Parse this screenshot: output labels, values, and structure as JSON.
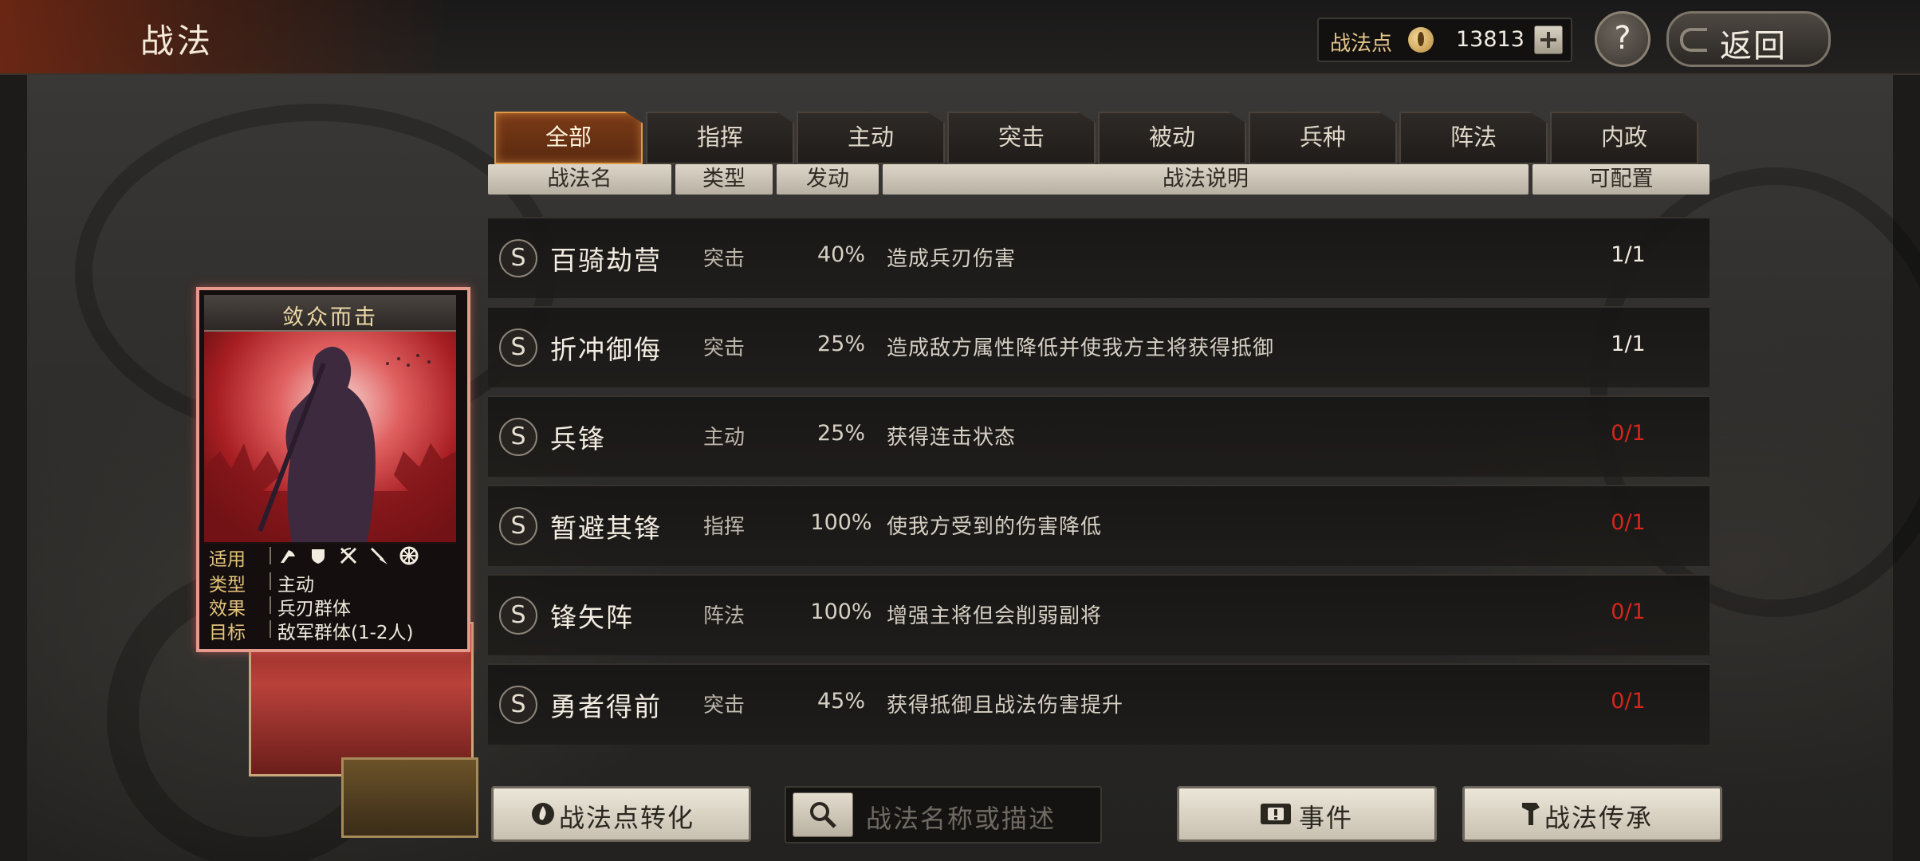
{
  "header": {
    "title": "战法",
    "points_label": "战法点",
    "points_value": "13813",
    "help_label": "?",
    "back_label": "返回"
  },
  "tabs": [
    {
      "label": "全部",
      "active": true
    },
    {
      "label": "指挥",
      "active": false
    },
    {
      "label": "主动",
      "active": false
    },
    {
      "label": "突击",
      "active": false
    },
    {
      "label": "被动",
      "active": false
    },
    {
      "label": "兵种",
      "active": false
    },
    {
      "label": "阵法",
      "active": false
    },
    {
      "label": "内政",
      "active": false
    }
  ],
  "columns": {
    "name": "战法名",
    "type": "类型",
    "rate": "发动",
    "desc": "战法说明",
    "config": "可配置"
  },
  "rows": [
    {
      "grade": "S",
      "name": "百骑劫营",
      "type": "突击",
      "rate": "40%",
      "desc": "造成兵刃伤害",
      "config": "1/1",
      "config_color": "#f2ece1"
    },
    {
      "grade": "S",
      "name": "折冲御侮",
      "type": "突击",
      "rate": "25%",
      "desc": "造成敌方属性降低并使我方主将获得抵御",
      "config": "1/1",
      "config_color": "#f2ece1"
    },
    {
      "grade": "S",
      "name": "兵锋",
      "type": "主动",
      "rate": "25%",
      "desc": "获得连击状态",
      "config": "0/1",
      "config_color": "#d4261c"
    },
    {
      "grade": "S",
      "name": "暂避其锋",
      "type": "指挥",
      "rate": "100%",
      "desc": "使我方受到的伤害降低",
      "config": "0/1",
      "config_color": "#d4261c"
    },
    {
      "grade": "S",
      "name": "锋矢阵",
      "type": "阵法",
      "rate": "100%",
      "desc": "增强主将但会削弱副将",
      "config": "0/1",
      "config_color": "#d4261c"
    },
    {
      "grade": "S",
      "name": "勇者得前",
      "type": "突击",
      "rate": "45%",
      "desc": "获得抵御且战法伤害提升",
      "config": "0/1",
      "config_color": "#d4261c"
    }
  ],
  "card": {
    "title": "敛众而击",
    "apply_label": "适用",
    "apply_icons": [
      "cavalry-axe-icon",
      "shield-icon",
      "crossed-bows-icon",
      "spear-icon",
      "wheel-icon"
    ],
    "type_label": "类型",
    "type_value": "主动",
    "effect_label": "效果",
    "effect_value": "兵刃群体",
    "target_label": "目标",
    "target_value": "敌军群体(1-2人)"
  },
  "bottom": {
    "convert_label": "战法点转化",
    "search_placeholder": "战法名称或描述",
    "event_label": "事件",
    "inherit_label": "战法传承"
  }
}
